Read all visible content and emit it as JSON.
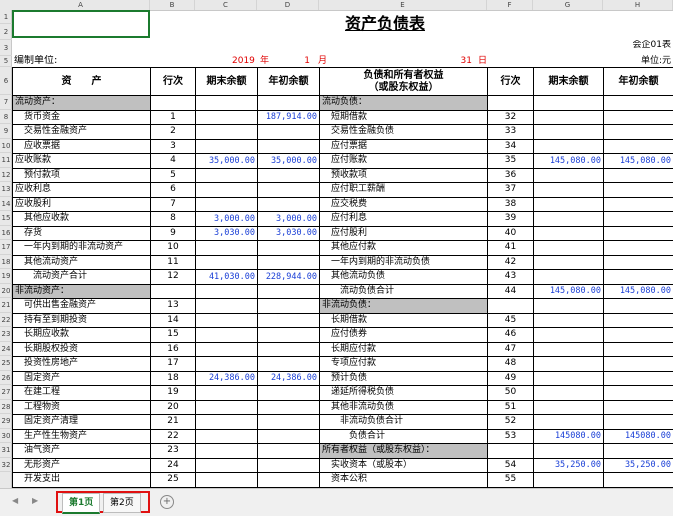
{
  "columns": [
    "A",
    "B",
    "C",
    "D",
    "E",
    "F",
    "G",
    "H"
  ],
  "rows": [
    "1",
    "2",
    "3",
    "5",
    "6",
    "7",
    "8",
    "9",
    "10",
    "11",
    "12",
    "13",
    "14",
    "15",
    "16",
    "17",
    "18",
    "19",
    "20",
    "21",
    "22",
    "23",
    "24",
    "25",
    "26",
    "27",
    "28",
    "29",
    "30",
    "31",
    "32"
  ],
  "title": "资产负债表",
  "form_no": "会企01表",
  "unit": "单位:元",
  "compiler_label": "编制单位:",
  "date": {
    "year": "2019",
    "year_unit": "年",
    "month": "1",
    "month_unit": "月",
    "day": "31",
    "day_unit": "日"
  },
  "headers": {
    "asset": "资　　产",
    "line": "行次",
    "end_balance": "期末余额",
    "begin_balance": "年初余额",
    "liab_1": "负债和所有者权益",
    "liab_2": "（或股东权益）",
    "line2": "行次",
    "end_balance2": "期末余额",
    "begin_balance2": "年初余额"
  },
  "table": [
    {
      "a": "流动资产：",
      "b": "",
      "c": "",
      "d": "",
      "e": "流动负债：",
      "f": "",
      "g": "",
      "h": "",
      "sec_a": true,
      "sec_e": true
    },
    {
      "a": "　货币资金",
      "b": "1",
      "c": "",
      "d": "187,914.00",
      "e": "　短期借款",
      "f": "32",
      "g": "",
      "h": ""
    },
    {
      "a": "　交易性金融资产",
      "b": "2",
      "c": "",
      "d": "",
      "e": "　交易性金融负债",
      "f": "33",
      "g": "",
      "h": ""
    },
    {
      "a": "　应收票据",
      "b": "3",
      "c": "",
      "d": "",
      "e": "　应付票据",
      "f": "34",
      "g": "",
      "h": ""
    },
    {
      "a": "应收账款",
      "b": "4",
      "c": "35,000.00",
      "d": "35,000.00",
      "e": "　应付账款",
      "f": "35",
      "g": "145,080.00",
      "h": "145,080.00"
    },
    {
      "a": "　预付款项",
      "b": "5",
      "c": "",
      "d": "",
      "e": "　预收款项",
      "f": "36",
      "g": "",
      "h": ""
    },
    {
      "a": "应收利息",
      "b": "6",
      "c": "",
      "d": "",
      "e": "　应付职工薪酬",
      "f": "37",
      "g": "",
      "h": ""
    },
    {
      "a": "应收股利",
      "b": "7",
      "c": "",
      "d": "",
      "e": "　应交税费",
      "f": "38",
      "g": "",
      "h": ""
    },
    {
      "a": "　其他应收款",
      "b": "8",
      "c": "3,000.00",
      "d": "3,000.00",
      "e": "　应付利息",
      "f": "39",
      "g": "",
      "h": ""
    },
    {
      "a": "　存货",
      "b": "9",
      "c": "3,030.00",
      "d": "3,030.00",
      "e": "　应付股利",
      "f": "40",
      "g": "",
      "h": ""
    },
    {
      "a": "　一年内到期的非流动资产",
      "b": "10",
      "c": "",
      "d": "",
      "e": "　其他应付款",
      "f": "41",
      "g": "",
      "h": ""
    },
    {
      "a": "　其他流动资产",
      "b": "11",
      "c": "",
      "d": "",
      "e": "　一年内到期的非流动负债",
      "f": "42",
      "g": "",
      "h": ""
    },
    {
      "a": "　　流动资产合计",
      "b": "12",
      "c": "41,030.00",
      "d": "228,944.00",
      "e": "　其他流动负债",
      "f": "43",
      "g": "",
      "h": ""
    },
    {
      "a": "非流动资产：",
      "b": "",
      "c": "",
      "d": "",
      "e": "　　流动负债合计",
      "f": "44",
      "g": "145,080.00",
      "h": "145,080.00",
      "sec_a": true
    },
    {
      "a": "　可供出售金融资产",
      "b": "13",
      "c": "",
      "d": "",
      "e": "非流动负债：",
      "f": "",
      "g": "",
      "h": "",
      "sec_e": true
    },
    {
      "a": "　持有至到期投资",
      "b": "14",
      "c": "",
      "d": "",
      "e": "　长期借款",
      "f": "45",
      "g": "",
      "h": ""
    },
    {
      "a": "　长期应收款",
      "b": "15",
      "c": "",
      "d": "",
      "e": "　应付债券",
      "f": "46",
      "g": "",
      "h": ""
    },
    {
      "a": "　长期股权投资",
      "b": "16",
      "c": "",
      "d": "",
      "e": "　长期应付款",
      "f": "47",
      "g": "",
      "h": ""
    },
    {
      "a": "　投资性房地产",
      "b": "17",
      "c": "",
      "d": "",
      "e": "　专项应付款",
      "f": "48",
      "g": "",
      "h": ""
    },
    {
      "a": "　固定资产",
      "b": "18",
      "c": "24,386.00",
      "d": "24,386.00",
      "e": "　预计负债",
      "f": "49",
      "g": "",
      "h": ""
    },
    {
      "a": "　在建工程",
      "b": "19",
      "c": "",
      "d": "",
      "e": "　递延所得税负债",
      "f": "50",
      "g": "",
      "h": ""
    },
    {
      "a": "　工程物资",
      "b": "20",
      "c": "",
      "d": "",
      "e": "　其他非流动负债",
      "f": "51",
      "g": "",
      "h": ""
    },
    {
      "a": "　固定资产清理",
      "b": "21",
      "c": "",
      "d": "",
      "e": "　　非流动负债合计",
      "f": "52",
      "g": "",
      "h": ""
    },
    {
      "a": "　生产性生物资产",
      "b": "22",
      "c": "",
      "d": "",
      "e": "　　　负债合计",
      "f": "53",
      "g": "145080.00",
      "h": "145080.00"
    },
    {
      "a": "　油气资产",
      "b": "23",
      "c": "",
      "d": "",
      "e": "所有者权益（或股东权益）：",
      "f": "",
      "g": "",
      "h": "",
      "sec_e": true
    },
    {
      "a": "　无形资产",
      "b": "24",
      "c": "",
      "d": "",
      "e": "　实收资本（或股本）",
      "f": "54",
      "g": "35,250.00",
      "h": "35,250.00"
    },
    {
      "a": "　开发支出",
      "b": "25",
      "c": "",
      "d": "",
      "e": "　资本公积",
      "f": "55",
      "g": "",
      "h": ""
    }
  ],
  "tabs": [
    "第1页",
    "第2页"
  ],
  "add_sheet_icon": "plus-circle-icon",
  "accent_color": "#1b7a2e",
  "highlight_color": "#e01010"
}
